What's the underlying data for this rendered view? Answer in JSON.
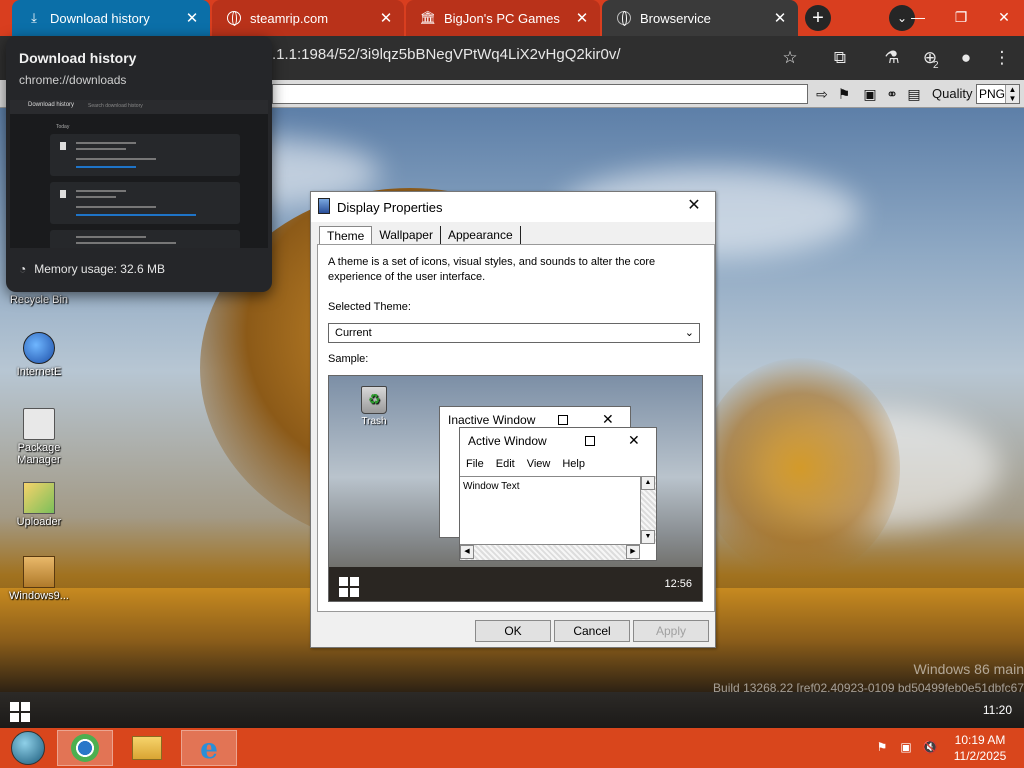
{
  "browser": {
    "tabs": [
      {
        "title": "Download history",
        "active": true
      },
      {
        "title": "steamrip.com",
        "active": false
      },
      {
        "title": "BigJon's PC Games Coll",
        "active": false
      },
      {
        "title": "Browservice",
        "active": false
      }
    ],
    "url": ".1.1:1984/52/3i9lqz5bBNegVPtWq4LiX2vHgQ2kir0v/",
    "download_badge": "2"
  },
  "download_popup": {
    "title": "Download history",
    "url": "chrome://downloads",
    "thumb_title": "Download history",
    "thumb_search": "Search download history",
    "thumb_section": "Today",
    "memory": "Memory usage: 32.6 MB"
  },
  "remote_toolbar": {
    "quality_label": "Quality",
    "quality_value": "PNG"
  },
  "desktop": {
    "icons": [
      {
        "label": "Recycle Bin"
      },
      {
        "label": "InternetE"
      },
      {
        "label": "Package Manager"
      },
      {
        "label": "Uploader"
      },
      {
        "label": "Windows9..."
      }
    ],
    "watermark_line1": "Windows 86 main",
    "watermark_line2": "Build 13268.22 [ref02.40923-0109 bd50499feb0e51dbfc67"
  },
  "dialog": {
    "title": "Display Properties",
    "tabs": [
      "Theme",
      "Wallpaper",
      "Appearance"
    ],
    "description": "A theme is a set of icons, visual styles, and sounds to alter the core experience of the user interface.",
    "selected_theme_label": "Selected Theme:",
    "selected_theme_value": "Current",
    "sample_label": "Sample:",
    "sample": {
      "trash_label": "Trash",
      "inactive_title": "Inactive Window",
      "active_title": "Active Window",
      "menu": [
        "File",
        "Edit",
        "View",
        "Help"
      ],
      "window_text": "Window Text",
      "clock": "12:56"
    },
    "buttons": {
      "ok": "OK",
      "cancel": "Cancel",
      "apply": "Apply"
    }
  },
  "remote_taskbar": {
    "clock": "11:20"
  },
  "host_taskbar": {
    "time": "10:19 AM",
    "date": "11/2/2025"
  }
}
